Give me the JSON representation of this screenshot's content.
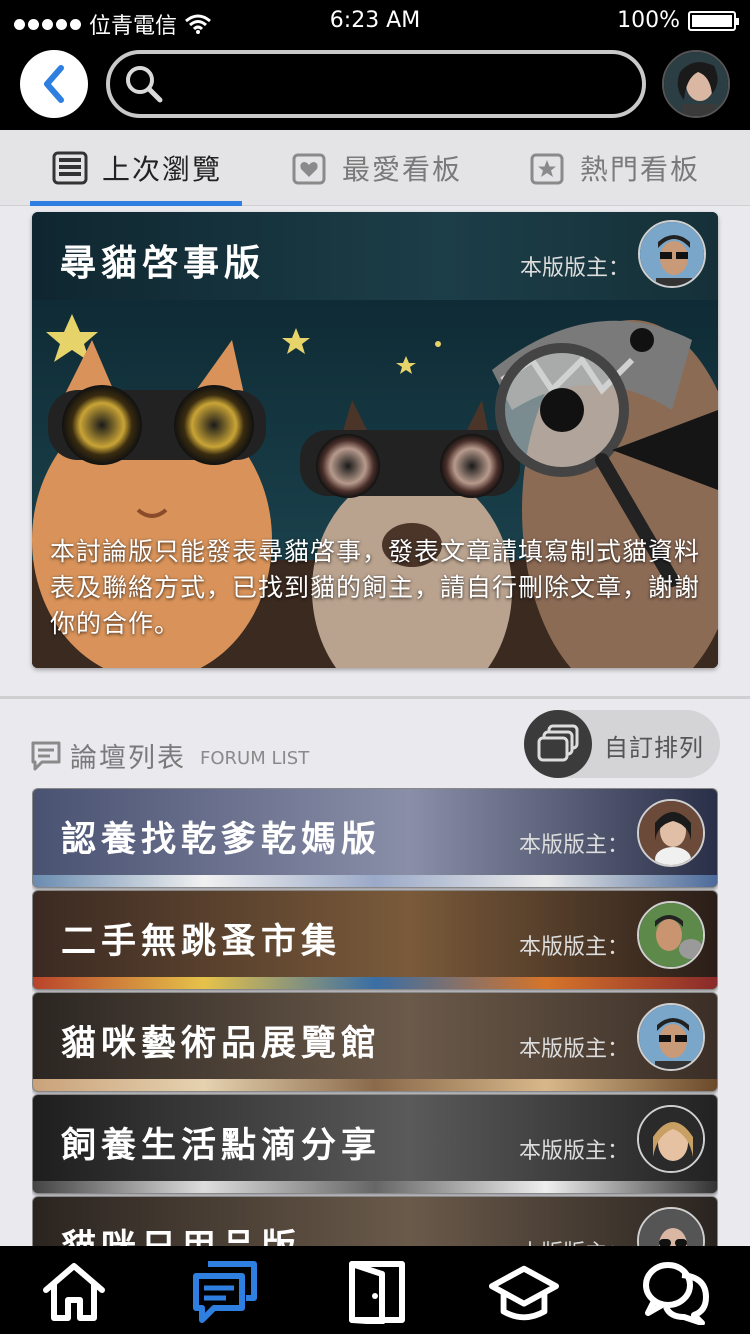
{
  "status_bar": {
    "carrier": "位青電信",
    "time": "6:23 AM",
    "battery": "100%"
  },
  "search": {
    "value": "",
    "placeholder": ""
  },
  "tabs": [
    {
      "label": "上次瀏覽",
      "icon": "recent-icon",
      "active": true
    },
    {
      "label": "最愛看板",
      "icon": "heart-board-icon",
      "active": false
    },
    {
      "label": "熱門看板",
      "icon": "star-board-icon",
      "active": false
    }
  ],
  "featured_board": {
    "title": "尋貓啓事版",
    "moderator_label": "本版版主：",
    "description": "本討論版只能發表尋貓啓事，發表文章請填寫制式貓資料表及聯絡方式，已找到貓的飼主，請自行刪除文章，謝謝你的合作。"
  },
  "forum_list": {
    "title": "論壇列表",
    "subtitle": "FORUM LIST",
    "sort_label": "自訂排列",
    "boards": [
      {
        "title": "認養找乾爹乾媽版",
        "moderator_label": "本版版主："
      },
      {
        "title": "二手無跳蚤市集",
        "moderator_label": "本版版主："
      },
      {
        "title": "貓咪藝術品展覽館",
        "moderator_label": "本版版主："
      },
      {
        "title": "飼養生活點滴分享",
        "moderator_label": "本版版主："
      },
      {
        "title": "貓咪日用品版",
        "moderator_label": "本版版主："
      }
    ]
  },
  "bottom_tabs": [
    {
      "icon": "home-icon",
      "active": false
    },
    {
      "icon": "forum-icon",
      "active": true
    },
    {
      "icon": "door-icon",
      "active": false
    },
    {
      "icon": "academy-icon",
      "active": false
    },
    {
      "icon": "chat-icon",
      "active": false
    }
  ],
  "colors": {
    "accent": "#2f7fe0",
    "header_bg": "#000000",
    "tab_bg": "#e4e4e6"
  }
}
